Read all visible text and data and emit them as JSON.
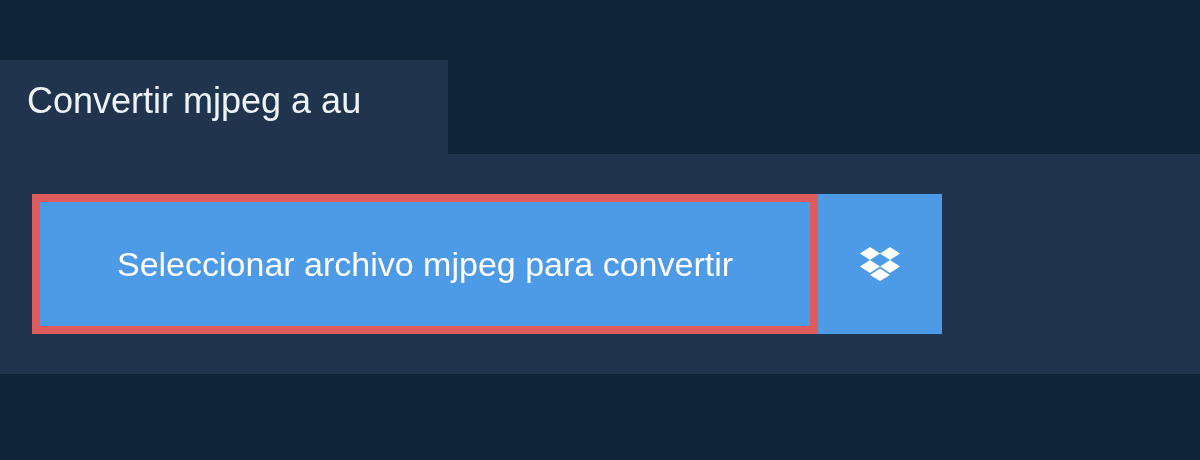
{
  "title": "Convertir mjpeg a au",
  "select_button": {
    "label": "Seleccionar archivo mjpeg para convertir",
    "focused": true
  }
}
